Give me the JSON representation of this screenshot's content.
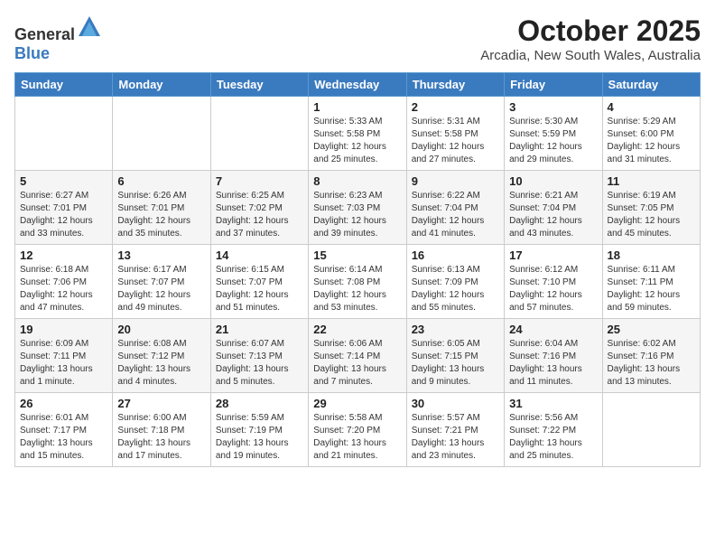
{
  "logo": {
    "general": "General",
    "blue": "Blue"
  },
  "header": {
    "month": "October 2025",
    "location": "Arcadia, New South Wales, Australia"
  },
  "days_of_week": [
    "Sunday",
    "Monday",
    "Tuesday",
    "Wednesday",
    "Thursday",
    "Friday",
    "Saturday"
  ],
  "weeks": [
    [
      {
        "day": "",
        "info": ""
      },
      {
        "day": "",
        "info": ""
      },
      {
        "day": "",
        "info": ""
      },
      {
        "day": "1",
        "info": "Sunrise: 5:33 AM\nSunset: 5:58 PM\nDaylight: 12 hours\nand 25 minutes."
      },
      {
        "day": "2",
        "info": "Sunrise: 5:31 AM\nSunset: 5:58 PM\nDaylight: 12 hours\nand 27 minutes."
      },
      {
        "day": "3",
        "info": "Sunrise: 5:30 AM\nSunset: 5:59 PM\nDaylight: 12 hours\nand 29 minutes."
      },
      {
        "day": "4",
        "info": "Sunrise: 5:29 AM\nSunset: 6:00 PM\nDaylight: 12 hours\nand 31 minutes."
      }
    ],
    [
      {
        "day": "5",
        "info": "Sunrise: 6:27 AM\nSunset: 7:01 PM\nDaylight: 12 hours\nand 33 minutes."
      },
      {
        "day": "6",
        "info": "Sunrise: 6:26 AM\nSunset: 7:01 PM\nDaylight: 12 hours\nand 35 minutes."
      },
      {
        "day": "7",
        "info": "Sunrise: 6:25 AM\nSunset: 7:02 PM\nDaylight: 12 hours\nand 37 minutes."
      },
      {
        "day": "8",
        "info": "Sunrise: 6:23 AM\nSunset: 7:03 PM\nDaylight: 12 hours\nand 39 minutes."
      },
      {
        "day": "9",
        "info": "Sunrise: 6:22 AM\nSunset: 7:04 PM\nDaylight: 12 hours\nand 41 minutes."
      },
      {
        "day": "10",
        "info": "Sunrise: 6:21 AM\nSunset: 7:04 PM\nDaylight: 12 hours\nand 43 minutes."
      },
      {
        "day": "11",
        "info": "Sunrise: 6:19 AM\nSunset: 7:05 PM\nDaylight: 12 hours\nand 45 minutes."
      }
    ],
    [
      {
        "day": "12",
        "info": "Sunrise: 6:18 AM\nSunset: 7:06 PM\nDaylight: 12 hours\nand 47 minutes."
      },
      {
        "day": "13",
        "info": "Sunrise: 6:17 AM\nSunset: 7:07 PM\nDaylight: 12 hours\nand 49 minutes."
      },
      {
        "day": "14",
        "info": "Sunrise: 6:15 AM\nSunset: 7:07 PM\nDaylight: 12 hours\nand 51 minutes."
      },
      {
        "day": "15",
        "info": "Sunrise: 6:14 AM\nSunset: 7:08 PM\nDaylight: 12 hours\nand 53 minutes."
      },
      {
        "day": "16",
        "info": "Sunrise: 6:13 AM\nSunset: 7:09 PM\nDaylight: 12 hours\nand 55 minutes."
      },
      {
        "day": "17",
        "info": "Sunrise: 6:12 AM\nSunset: 7:10 PM\nDaylight: 12 hours\nand 57 minutes."
      },
      {
        "day": "18",
        "info": "Sunrise: 6:11 AM\nSunset: 7:11 PM\nDaylight: 12 hours\nand 59 minutes."
      }
    ],
    [
      {
        "day": "19",
        "info": "Sunrise: 6:09 AM\nSunset: 7:11 PM\nDaylight: 13 hours\nand 1 minute."
      },
      {
        "day": "20",
        "info": "Sunrise: 6:08 AM\nSunset: 7:12 PM\nDaylight: 13 hours\nand 4 minutes."
      },
      {
        "day": "21",
        "info": "Sunrise: 6:07 AM\nSunset: 7:13 PM\nDaylight: 13 hours\nand 5 minutes."
      },
      {
        "day": "22",
        "info": "Sunrise: 6:06 AM\nSunset: 7:14 PM\nDaylight: 13 hours\nand 7 minutes."
      },
      {
        "day": "23",
        "info": "Sunrise: 6:05 AM\nSunset: 7:15 PM\nDaylight: 13 hours\nand 9 minutes."
      },
      {
        "day": "24",
        "info": "Sunrise: 6:04 AM\nSunset: 7:16 PM\nDaylight: 13 hours\nand 11 minutes."
      },
      {
        "day": "25",
        "info": "Sunrise: 6:02 AM\nSunset: 7:16 PM\nDaylight: 13 hours\nand 13 minutes."
      }
    ],
    [
      {
        "day": "26",
        "info": "Sunrise: 6:01 AM\nSunset: 7:17 PM\nDaylight: 13 hours\nand 15 minutes."
      },
      {
        "day": "27",
        "info": "Sunrise: 6:00 AM\nSunset: 7:18 PM\nDaylight: 13 hours\nand 17 minutes."
      },
      {
        "day": "28",
        "info": "Sunrise: 5:59 AM\nSunset: 7:19 PM\nDaylight: 13 hours\nand 19 minutes."
      },
      {
        "day": "29",
        "info": "Sunrise: 5:58 AM\nSunset: 7:20 PM\nDaylight: 13 hours\nand 21 minutes."
      },
      {
        "day": "30",
        "info": "Sunrise: 5:57 AM\nSunset: 7:21 PM\nDaylight: 13 hours\nand 23 minutes."
      },
      {
        "day": "31",
        "info": "Sunrise: 5:56 AM\nSunset: 7:22 PM\nDaylight: 13 hours\nand 25 minutes."
      },
      {
        "day": "",
        "info": ""
      }
    ]
  ]
}
